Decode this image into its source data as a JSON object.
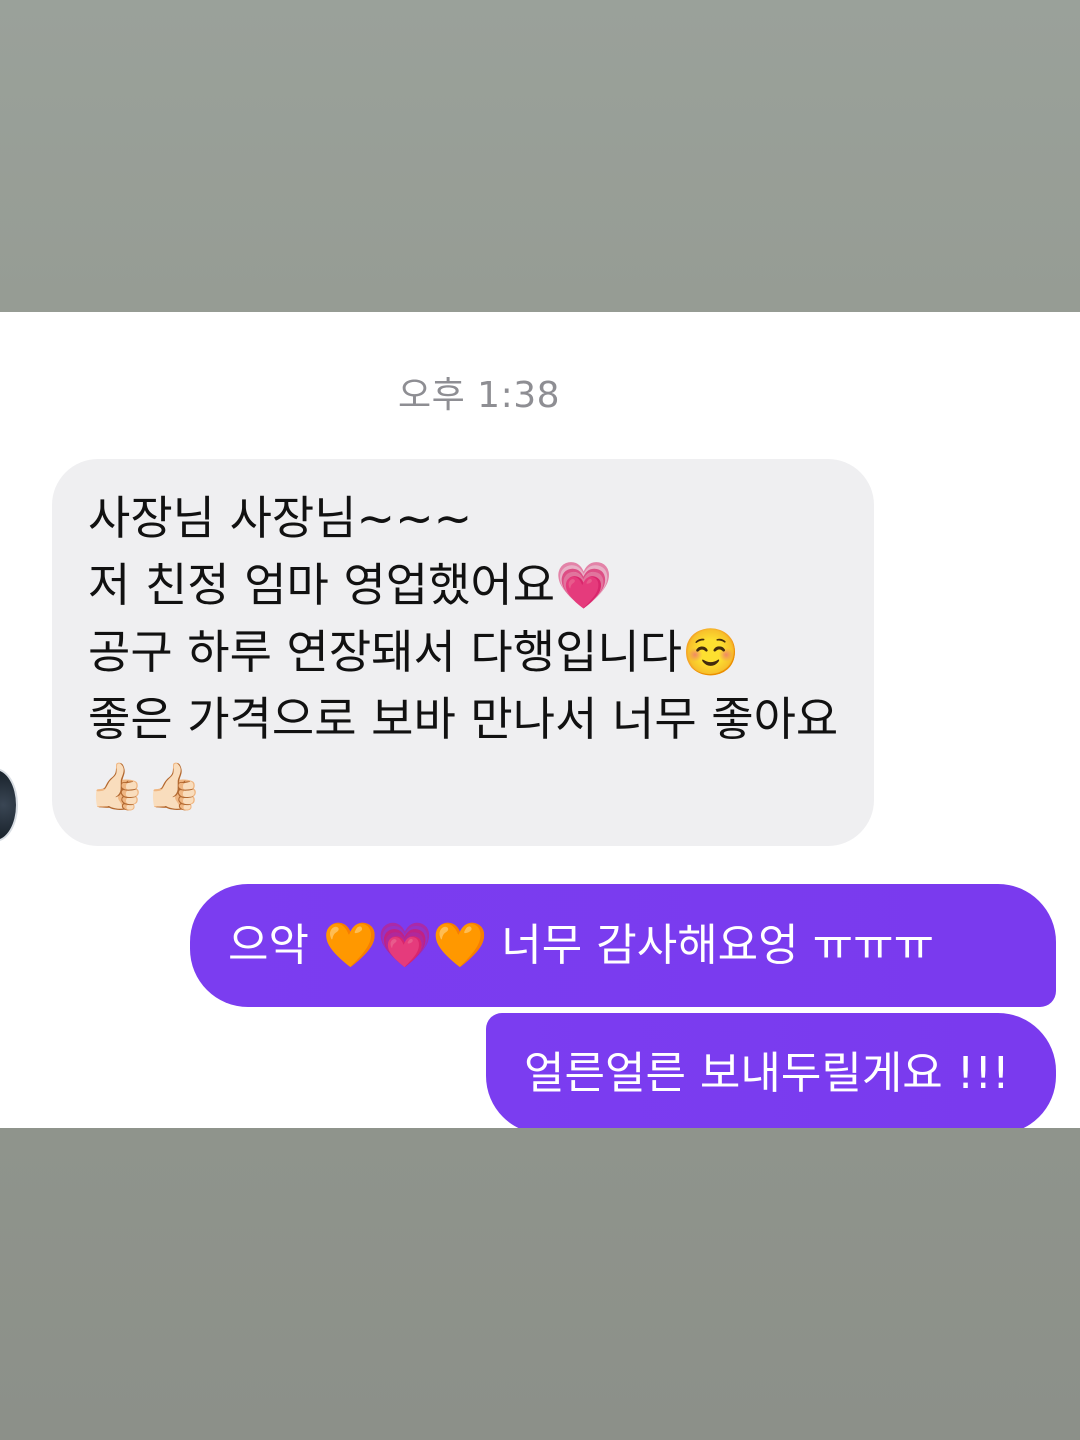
{
  "timestamp": "오후 1:38",
  "incoming": {
    "lines": [
      "사장님 사장님~~~",
      "저 친정 엄마 영업했어요💗",
      "공구 하루 연장돼서 다행입니다☺️",
      "좋은 가격으로 보바 만나서 너무 좋아요",
      "👍🏻👍🏻"
    ]
  },
  "outgoing": [
    "으악 🧡💗🧡  너무 감사해요엉 ㅠㅠㅠ",
    "얼른얼른 보내두릴게요 !!!"
  ],
  "colors": {
    "outgoing_bubble": "#7b3df0",
    "incoming_bubble": "#efeff1",
    "timestamp": "#8e8e93"
  }
}
